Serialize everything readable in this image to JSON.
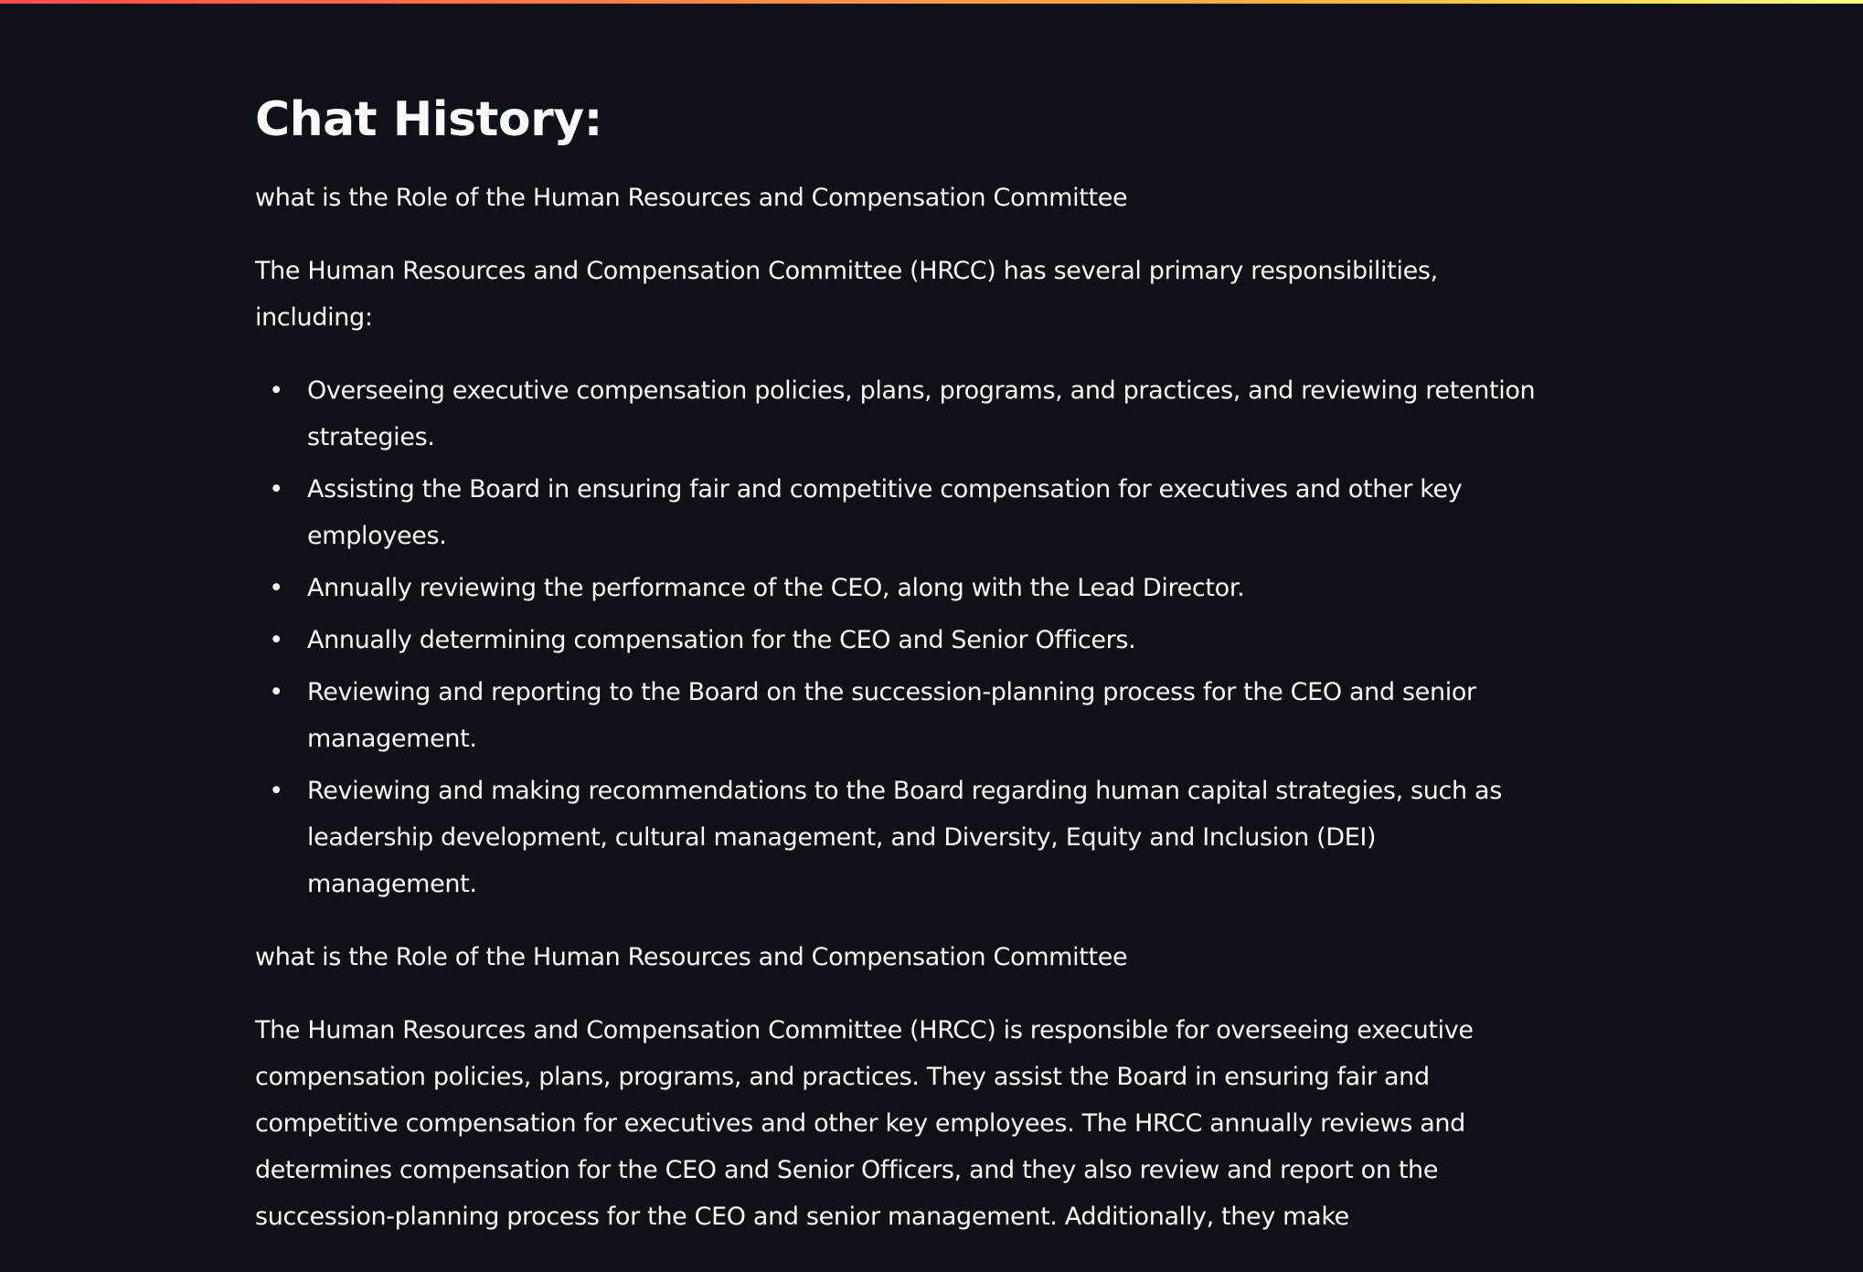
{
  "page": {
    "heading": "Chat History:",
    "accent_gradient": [
      "#ff4b4b",
      "#ffbd45",
      "#fffd80"
    ],
    "background": "#0e1117",
    "text_color": "#fafafa"
  },
  "chat": {
    "messages": [
      {
        "role": "user",
        "text": "what is the Role of the Human Resources and Compensation Committee"
      },
      {
        "role": "assistant",
        "intro": "The Human Resources and Compensation Committee (HRCC) has several primary responsibilities, including:",
        "bullets": [
          "Overseeing executive compensation policies, plans, programs, and practices, and reviewing retention strategies.",
          "Assisting the Board in ensuring fair and competitive compensation for executives and other key employees.",
          "Annually reviewing the performance of the CEO, along with the Lead Director.",
          "Annually determining compensation for the CEO and Senior Officers.",
          "Reviewing and reporting to the Board on the succession-planning process for the CEO and senior management.",
          "Reviewing and making recommendations to the Board regarding human capital strategies, such as leadership development, cultural management, and Diversity, Equity and Inclusion (DEI) management."
        ]
      },
      {
        "role": "user",
        "text": "what is the Role of the Human Resources and Compensation Committee"
      },
      {
        "role": "assistant",
        "text": "The Human Resources and Compensation Committee (HRCC) is responsible for overseeing executive compensation policies, plans, programs, and practices. They assist the Board in ensuring fair and competitive compensation for executives and other key employees. The HRCC annually reviews and determines compensation for the CEO and Senior Officers, and they also review and report on the succession-planning process for the CEO and senior management. Additionally, they make"
      }
    ],
    "bullet_glyph": "•"
  }
}
